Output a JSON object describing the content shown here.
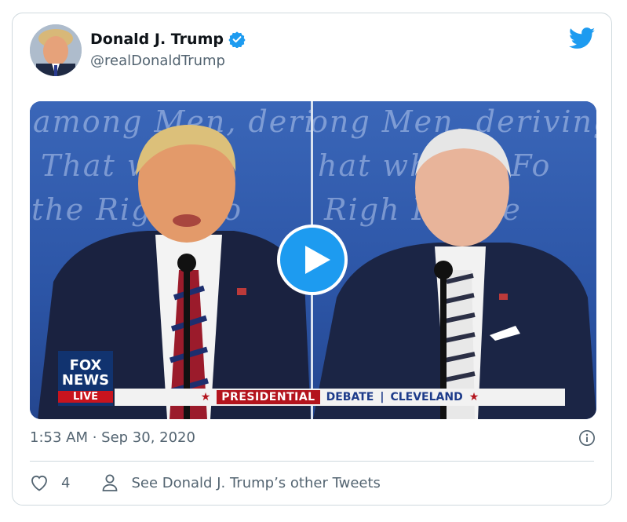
{
  "tweet": {
    "author_name": "Donald J. Trump",
    "handle": "@realDonaldTrump",
    "timestamp": "1:53 AM · Sep 30, 2020",
    "like_count": "4",
    "other_tweets_label": "See Donald J. Trump’s other Tweets"
  },
  "video": {
    "backdrop_text_left": [
      "among Men, deriving",
      "That w   any",
      "the Righ   Peo"
    ],
    "backdrop_text_right": [
      "ong Men, deriving",
      "hat wh   any Fo",
      "Righ   People"
    ],
    "fox_logo": [
      "FOX",
      "NEWS",
      "LIVE"
    ],
    "lower_third": {
      "presidential": "PRESIDENTIAL",
      "debate": "DEBATE",
      "city": "CLEVELAND"
    }
  },
  "icons": {
    "verified": "verified-badge-icon",
    "bird": "twitter-bird-icon",
    "play": "play-icon",
    "info": "info-icon",
    "heart": "heart-icon",
    "person": "person-icon"
  },
  "colors": {
    "twitter_blue": "#1d9bf0",
    "secondary_text": "#536471",
    "border": "#cfd9de",
    "fox_red": "#c8141e",
    "fox_blue": "#11336f"
  }
}
